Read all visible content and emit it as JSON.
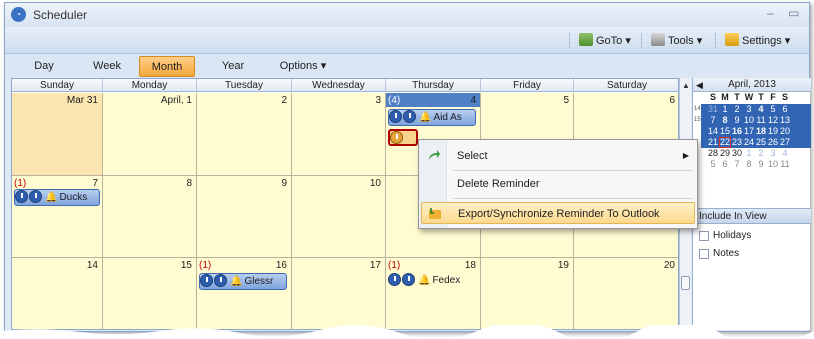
{
  "app": {
    "title": "Scheduler",
    "icon": "scheduler-icon"
  },
  "toolbar": {
    "goto_label": "GoTo ▾",
    "tools_label": "Tools ▾",
    "settings_label": "Settings ▾"
  },
  "tabs": [
    {
      "label": "Day",
      "active": false
    },
    {
      "label": "Week",
      "active": false
    },
    {
      "label": "Month",
      "active": true
    },
    {
      "label": "Year",
      "active": false
    },
    {
      "label": "Options ▾",
      "active": false
    }
  ],
  "calendar": {
    "day_headers": [
      "Sunday",
      "Monday",
      "Tuesday",
      "Wednesday",
      "Thursday",
      "Friday",
      "Saturday"
    ],
    "weeks": [
      {
        "days": [
          "Mar 31",
          "April, 1",
          "2",
          "3",
          "4",
          "5",
          "6"
        ]
      },
      {
        "days": [
          "7",
          "8",
          "9",
          "10",
          "",
          "",
          ""
        ]
      },
      {
        "days": [
          "14",
          "15",
          "16",
          "17",
          "18",
          "19",
          "20"
        ]
      }
    ],
    "counts": {
      "w1_thu": "(4)",
      "w2_sun": "(1)",
      "w3_tue": "(1)",
      "w3_wed": "(1)"
    },
    "events": {
      "aid": "Aid As",
      "ducks": "Ducks",
      "glessr": "Glessr",
      "fedex": "Fedex"
    }
  },
  "context_menu": {
    "items": [
      {
        "label": "Select",
        "submenu": true
      },
      {
        "label": "Delete Reminder",
        "submenu": false
      },
      {
        "label": "Export/Synchronize Reminder To  Outlook",
        "submenu": false,
        "highlighted": true
      }
    ]
  },
  "mini_calendar": {
    "title": "April, 2013",
    "dow": [
      "S",
      "M",
      "T",
      "W",
      "T",
      "F",
      "S"
    ],
    "rows": [
      {
        "week": "14",
        "days": [
          "31",
          "1",
          "2",
          "3",
          "4",
          "5",
          "6"
        ]
      },
      {
        "week": "15",
        "days": [
          "7",
          "8",
          "9",
          "10",
          "11",
          "12",
          "13"
        ]
      },
      {
        "week": "",
        "days": [
          "14",
          "15",
          "16",
          "17",
          "18",
          "19",
          "20"
        ]
      },
      {
        "week": "",
        "days": [
          "21",
          "22",
          "23",
          "24",
          "25",
          "26",
          "27"
        ]
      },
      {
        "week": "",
        "days": [
          "28",
          "29",
          "30",
          "1",
          "2",
          "3",
          "4"
        ]
      },
      {
        "week": "",
        "days": [
          "5",
          "6",
          "7",
          "8",
          "9",
          "10",
          "11"
        ]
      }
    ]
  },
  "include_in_view": {
    "title": "Include In View",
    "options": [
      {
        "label": "Holidays",
        "checked": false
      },
      {
        "label": "Notes",
        "checked": false
      }
    ]
  },
  "colors": {
    "accent_tab": "#f5a63c",
    "cell_bg": "#fffcd2",
    "other_month_bg": "#fbe5b0",
    "selection": "#3165b4",
    "count_red": "#c00000"
  }
}
